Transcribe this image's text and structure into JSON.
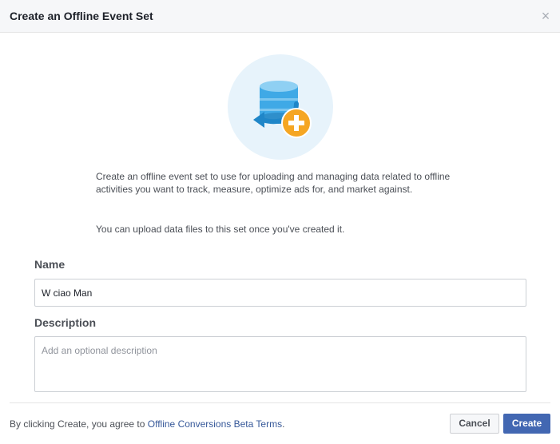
{
  "dialog": {
    "title": "Create an Offline Event Set",
    "close_symbol": "×",
    "illustration_icon": "database-plus-icon"
  },
  "intro": {
    "paragraph_1": "Create an offline event set to use for uploading and managing data related to offline activities you want to track, measure, optimize ads for, and market against.",
    "paragraph_2": "You can upload data files to this set once you've created it."
  },
  "form": {
    "name_label": "Name",
    "name_value": "W ciao Man",
    "description_label": "Description",
    "description_placeholder": "Add an optional description",
    "description_value": ""
  },
  "footer": {
    "terms_prefix": "By clicking Create, you agree to ",
    "terms_link": "Offline Conversions Beta Terms",
    "terms_suffix": ".",
    "cancel_label": "Cancel",
    "create_label": "Create"
  },
  "colors": {
    "primary": "#4267b2",
    "link": "#365899",
    "illustration_bg": "#e7f3fb",
    "icon_blue": "#3fa9e6",
    "icon_orange": "#f5a623"
  }
}
